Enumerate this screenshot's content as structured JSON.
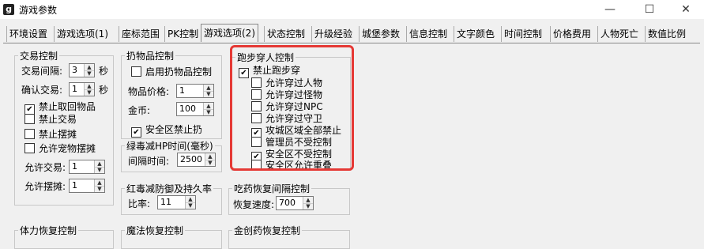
{
  "window": {
    "title": "游戏参数",
    "app_icon": "g",
    "minimize": "—",
    "maximize": "☐",
    "close": "✕"
  },
  "tabs": [
    "环境设置",
    "游戏选项(1)",
    "座标范围",
    "PK控制",
    "游戏选项(2)",
    "状态控制",
    "升级经验",
    "城堡参数",
    "信息控制",
    "文字颜色",
    "时间控制",
    "价格费用",
    "人物死亡",
    "数值比例"
  ],
  "active_tab": "游戏选项(2)",
  "trade": {
    "legend": "交易控制",
    "interval_label": "交易间隔:",
    "interval_value": "3",
    "interval_unit": "秒",
    "confirm_label": "确认交易:",
    "confirm_value": "1",
    "confirm_unit": "秒",
    "cb_no_take": "禁止取回物品",
    "cb_no_take_checked": "✔",
    "cb_no_trade": "禁止交易",
    "cb_no_stall": "禁止摆摊",
    "cb_pet_stall": "允许宠物摆摊",
    "allow_trade_label": "允许交易:",
    "allow_trade_value": "1",
    "allow_stall_label": "允许摆摊:",
    "allow_stall_value": "1"
  },
  "drop": {
    "legend": "扔物品控制",
    "cb_enable": "启用扔物品控制",
    "price_label": "物品价格:",
    "price_value": "1",
    "gold_label": "金币:",
    "gold_value": "100",
    "cb_safe": "安全区禁止扔",
    "cb_safe_checked": "✔"
  },
  "green_poison": {
    "legend": "绿毒减HP时间(毫秒)",
    "interval_label": "间隔时间:",
    "interval_value": "2500"
  },
  "red_poison": {
    "legend": "红毒减防御及持久率",
    "ratio_label": "比率:",
    "ratio_value": "11"
  },
  "run_through": {
    "legend": "跑步穿人控制",
    "items": [
      {
        "label": "禁止跑步穿",
        "mark": "✔"
      },
      {
        "label": "允许穿过人物",
        "mark": ""
      },
      {
        "label": "允许穿过怪物",
        "mark": ""
      },
      {
        "label": "允许穿过NPC",
        "mark": ""
      },
      {
        "label": "允许穿过守卫",
        "mark": ""
      },
      {
        "label": "攻城区域全部禁止",
        "mark": "✔"
      },
      {
        "label": "管理员不受控制",
        "mark": ""
      },
      {
        "label": "安全区不受控制",
        "mark": "✔"
      },
      {
        "label": "安全区允许重叠",
        "mark": ""
      }
    ]
  },
  "potion": {
    "legend": "吃药恢复间隔控制",
    "speed_label": "恢复速度:",
    "speed_value": "700"
  },
  "bottom_groups": {
    "stamina": "体力恢复控制",
    "magic": "魔法恢复控制",
    "golden": "金创药恢复控制"
  },
  "spin_up": "▲",
  "spin_down": "▼",
  "colors": {
    "highlight": "#e53935",
    "background": "#f0f0f0"
  }
}
